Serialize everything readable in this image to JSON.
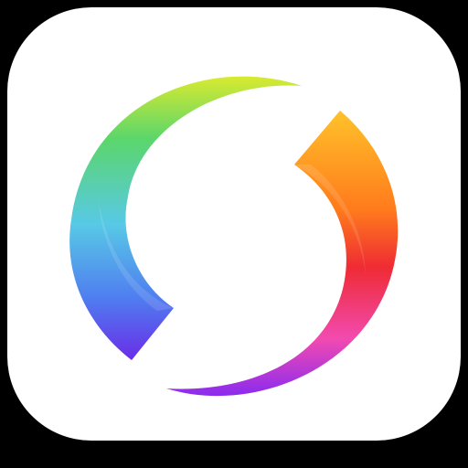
{
  "icon": {
    "name": "app-icon",
    "symbol": "rainbow-swirl-s-icon",
    "background_color": "#ffffff",
    "surround_color": "#000000",
    "colors": {
      "cool_top": "#d9ea2f",
      "cool_upper": "#5bd66b",
      "cool_mid": "#58c9e6",
      "cool_low": "#4f7ef0",
      "cool_bottom": "#6a2ce8",
      "warm_top": "#ffc22a",
      "warm_mid": "#ff7a1c",
      "warm_right": "#ef2b34",
      "warm_low": "#f24ab0",
      "warm_bottom": "#8a2bf0"
    }
  }
}
